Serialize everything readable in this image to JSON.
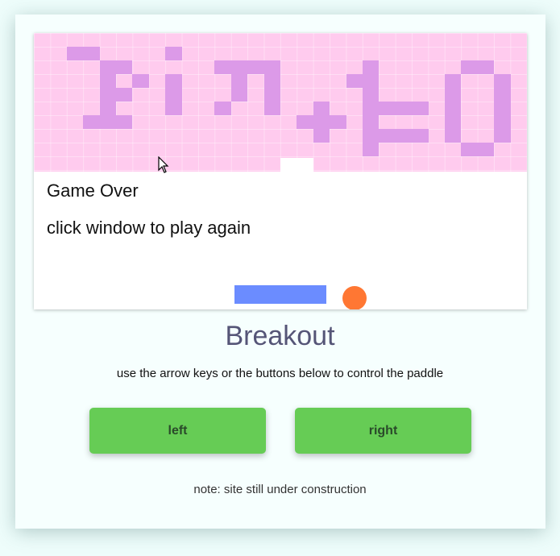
{
  "game": {
    "status": "Game Over",
    "prompt": "click window to play again",
    "brick_pattern": "e^(iπ)+1=0",
    "colors": {
      "brick_area": "#ffcbee",
      "brick": "#dc9ae8",
      "paddle": "#6b8cff",
      "ball": "#ff7733"
    }
  },
  "page": {
    "title": "Breakout",
    "instructions": "use the arrow keys or the buttons below to control the paddle",
    "note": "note: site still under construction"
  },
  "controls": {
    "left_label": "left",
    "right_label": "right",
    "button_color": "#66cc55"
  }
}
